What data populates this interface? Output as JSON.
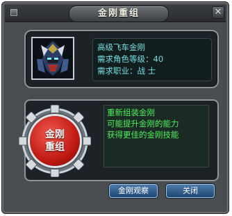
{
  "window": {
    "title": "金刚重组"
  },
  "titlebar": {
    "minimize_icon": "minimize-icon",
    "close_icon": "close-icon",
    "close_glyph": "✕"
  },
  "item": {
    "portrait_icon": "armored-helmet-icon",
    "lines": [
      "高级飞车金刚",
      "需求角色等级：40",
      "需求职业：战 士"
    ]
  },
  "reforge": {
    "label": "金刚\n重组",
    "accent_color": "#d22a1f"
  },
  "description": {
    "lines": [
      "重新组装金刚",
      "可能提升金刚的能力",
      "获得更佳的金刚技能"
    ],
    "text_color": "#4ef25b"
  },
  "buttons": {
    "observe_label": "金刚观察",
    "close_label": "关闭"
  },
  "colors": {
    "info_text": "#76dfe0",
    "button_blue": "#2f5d8e"
  }
}
